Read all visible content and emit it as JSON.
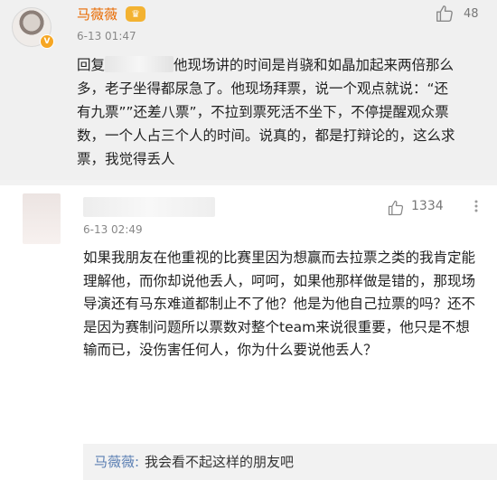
{
  "comment1": {
    "username": "马薇薇",
    "vip_badge_icon": "crown-badge-icon",
    "verified_icon": "v-verified-icon",
    "time": "6-13 01:47",
    "likes": "48",
    "text_prefix": "回复",
    "text_rest": "他现场讲的时间是肖骁和如晶加起来两倍那么多，老子坐得都尿急了。他现场拜票，说一个观点就说：“还有九票””还差八票”，不拉到票死活不坐下，不停提醒观众票数，一个人占三个人的时间。说真的，都是打辩论的，这么求票，我觉得丢人"
  },
  "comment2": {
    "time": "6-13 02:49",
    "likes": "1334",
    "text": "如果我朋友在他重视的比赛里因为想赢而去拉票之类的我肯定能理解他，而你却说他丢人，呵呵，如果他那样做是错的，那现场导演还有马东难道都制止不了他？他是为他自己拉票的吗？还不是因为赛制问题所以票数对整个team来说很重要，他只是不想输而已，没伤害任何人，你为什么要说他丢人？",
    "reply": {
      "name": "马薇薇:",
      "text": "我会看不起这样的朋友吧"
    }
  },
  "colors": {
    "username": "#e86a00",
    "reply_name": "#5b7fb3",
    "time": "#888888"
  }
}
